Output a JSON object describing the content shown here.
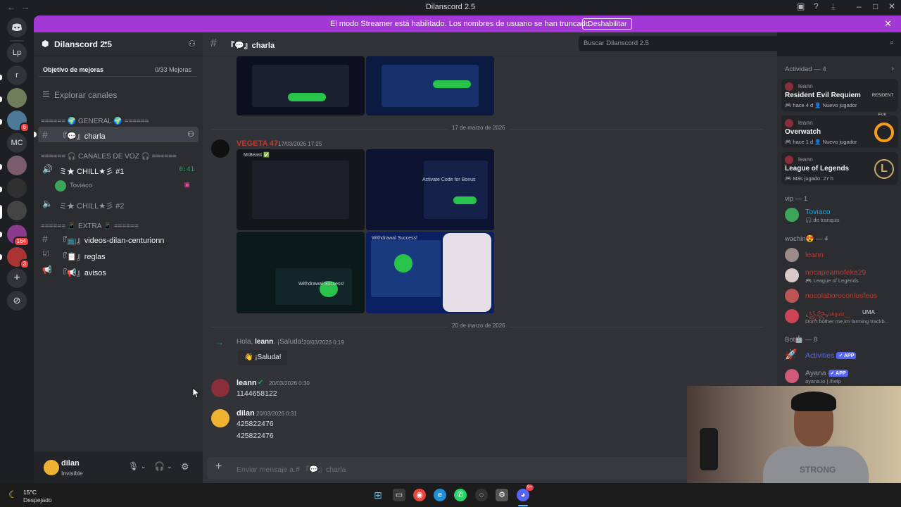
{
  "titlebar": {
    "title": "Dilanscord 2.5"
  },
  "banner": {
    "message": "El modo Streamer está habilitado. Los nombres de usuario se han truncado.",
    "button": "Deshabilitar"
  },
  "rail": {
    "servers": [
      {
        "label": "Lp",
        "badge": ""
      },
      {
        "label": "r",
        "badge": ""
      },
      {
        "label": "",
        "badge": ""
      },
      {
        "label": "",
        "badge": "6"
      },
      {
        "label": "MC",
        "badge": ""
      },
      {
        "label": "",
        "badge": ""
      },
      {
        "label": "",
        "badge": ""
      },
      {
        "label": "",
        "badge": ""
      },
      {
        "label": "",
        "badge": "164"
      },
      {
        "label": "",
        "badge": "3"
      }
    ]
  },
  "sidebar": {
    "server_name": "Dilanscord 2.5",
    "boost_label": "Objetivo de mejoras",
    "boost_progress": "0/33 Mejoras",
    "explore": "Explorar canales",
    "cat_general": "====== 🌍 GENERAL 🌍 ======",
    "chan_charla": "『💬』charla",
    "cat_voice": "====== 🎧 CANALES DE VOZ 🎧 ======",
    "vc1": "ミ★ CHILL★彡 #1",
    "vc1_timer": "0:41",
    "vc1_user": "Toviaco",
    "vc2": "ミ★ CHILL★彡 #2",
    "cat_extra": "====== 📱 EXTRA 📱 ======",
    "chan_videos": "『📺』videos-dilan-centurionn",
    "chan_reglas": "『📋』reglas",
    "chan_avisos": "『📢』avisos"
  },
  "user": {
    "name": "dilan",
    "status": "Invisible"
  },
  "header": {
    "channel": "『💬』charla",
    "search_placeholder": "Buscar Dilanscord 2.5"
  },
  "chat": {
    "date1": "17 de marzo de 2026",
    "author1": "VEGETA 47",
    "time1": "17/03/2026 17:25",
    "img_caption1": "MrBeast ✅",
    "img_caption2": "Activate Code for Bonus",
    "img_caption3": "Withdrawal Success!",
    "img_caption4": "Withdrawal Success!",
    "date2": "20 de marzo de 2026",
    "welcome_pre": "Hola, ",
    "welcome_user": "leann",
    "welcome_post": ". ¡Saluda!",
    "welcome_time": "20/03/2026 0:19",
    "wave_button": "👋 ¡Saluda!",
    "author2": "leann",
    "time2": "20/03/2026 0:30",
    "msg2": "1144658122",
    "author3": "dilan",
    "time3": "20/03/2026 0:31",
    "msg3a": "425822476",
    "msg3b": "425822476",
    "composer_placeholder": "Enviar mensaje a # 『💬』charla"
  },
  "members": {
    "activity_header": "Actividad — 4",
    "activities": [
      {
        "user": "leann",
        "game": "Resident Evil Requiem",
        "meta": "🎮 hace 4 d  👤 Nuevo jugador",
        "logo": "RESIDENT EVIL"
      },
      {
        "user": "leann",
        "game": "Overwatch",
        "meta": "🎮 hace 1 d  👤 Nuevo jugador",
        "logo": ""
      },
      {
        "user": "leann",
        "game": "League of Legends",
        "meta": "🎮 Más jugado: 27 h",
        "logo": "L"
      }
    ],
    "vip_header": "vip — 1",
    "vip": [
      {
        "name": "Toviaco",
        "status": "🎧 de tranquis"
      }
    ],
    "wachin_header": "wachin😍 — 4",
    "wachin": [
      {
        "name": "leann",
        "status": ""
      },
      {
        "name": "nocapeamofeka29",
        "status": "🎮 League of Legends"
      },
      {
        "name": "nocolaboroconlosfeos",
        "status": ""
      },
      {
        "name": "꧁꧂ᵒᴬᵍᵘˢᵗ...",
        "status": "Don't bother me,im farming trackb..."
      }
    ],
    "wachin_tag": "UMA",
    "bot_header": "Bot🤖 — 8",
    "bots": [
      {
        "name": "Activities",
        "status": "",
        "tag": "✓ APP"
      },
      {
        "name": "Ayana",
        "status": "ayana.io | /help",
        "tag": "✓ APP"
      }
    ]
  },
  "webcam": {
    "shirt_text": "STRONG"
  },
  "taskbar": {
    "temp": "15°C",
    "weather": "Despejado",
    "discord_badge": "9+"
  }
}
